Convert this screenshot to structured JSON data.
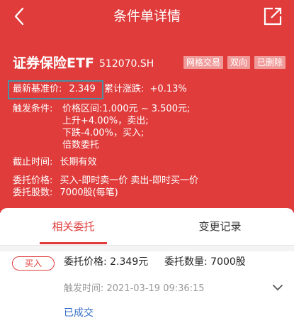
{
  "nav": {
    "title": "条件单详情",
    "back_icon": "chevron-left-icon",
    "share_icon": "external-link-icon"
  },
  "stock": {
    "name": "证券保险ETF",
    "code": "512070.SH",
    "tags": [
      "网格交易",
      "双向",
      "已删除"
    ]
  },
  "info": {
    "base_price_label": "最新基准价:",
    "base_price_value": "2.349",
    "cum_change_label": "累计涨跌:",
    "cum_change_value": "+0.13%",
    "trigger_label": "触发条件:",
    "trigger_lines": [
      "价格区间:1.000元 ~ 3.500元;",
      "上升+4.00%，卖出;",
      "下跌-4.00%，买入;",
      "倍数委托"
    ],
    "deadline_label": "截止时间:",
    "deadline_value": "长期有效",
    "order_price_label": "委托价格:",
    "order_price_value": "买入-即时卖一价 卖出-即时买一价",
    "order_qty_label": "委托股数:",
    "order_qty_value": "7000股(每笔)"
  },
  "tabs": {
    "active": "相关委托",
    "inactive": "变更记录"
  },
  "order": {
    "side_badge": "买入",
    "price_text": "委托价格: 2.349元",
    "qty_text": "委托数量: 7000股",
    "trigger_time": "触发时间: 2021-03-19 09:36:15",
    "status": "已成交",
    "status_color": "#3a72c8",
    "expand_icon": "chevron-down-icon"
  },
  "colors": {
    "brand": "#e03c3c",
    "highlight_box": "#4a8fa3"
  }
}
